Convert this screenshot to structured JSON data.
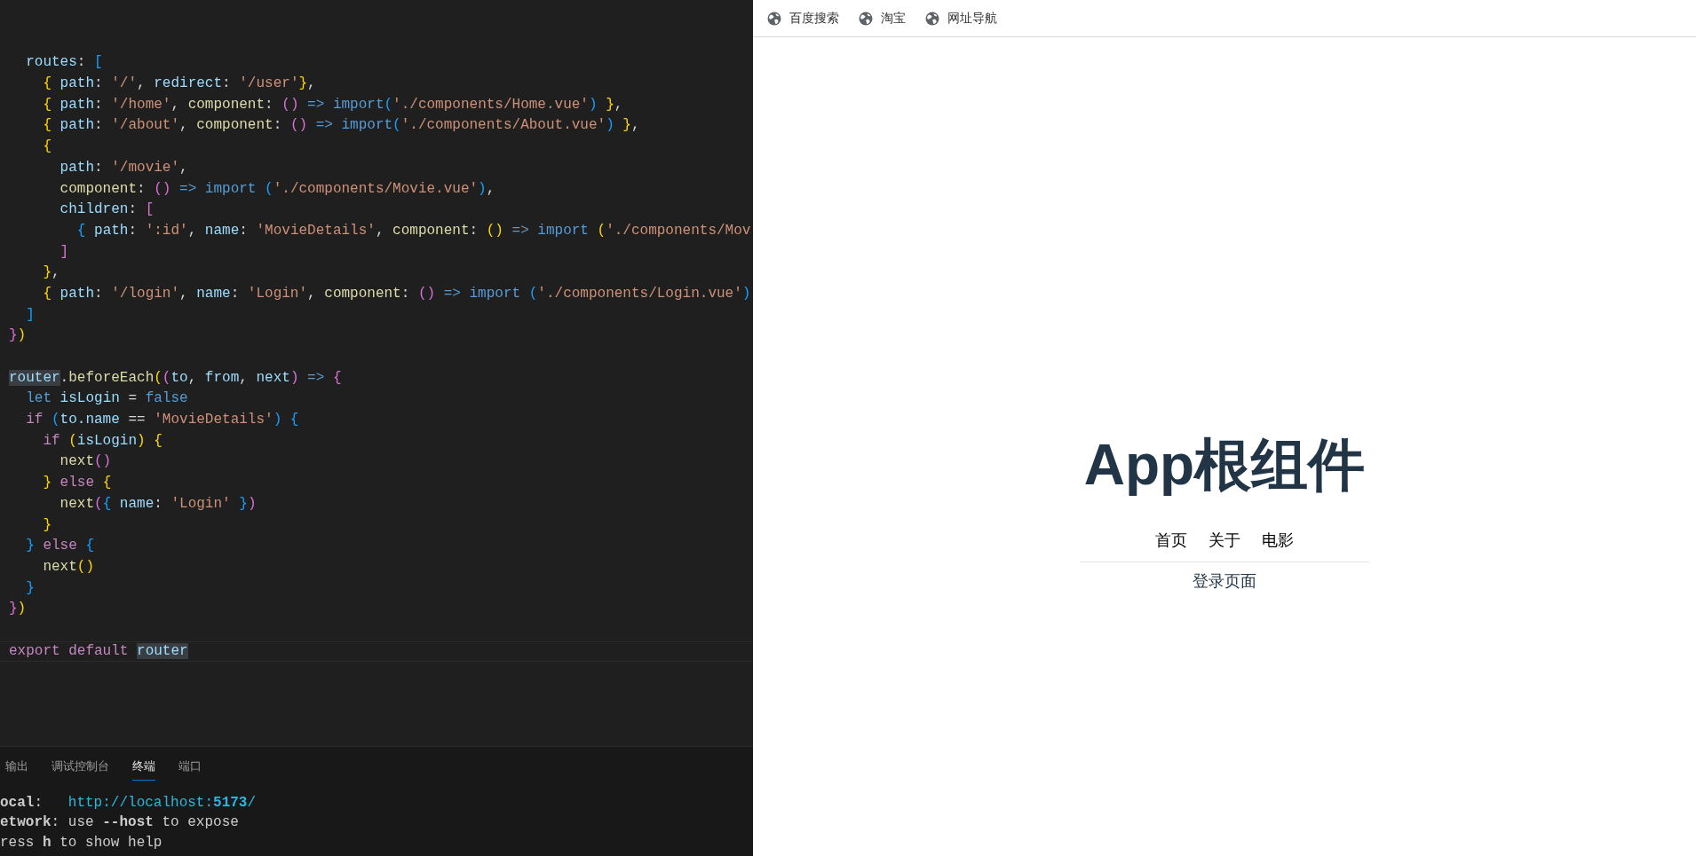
{
  "editor": {
    "lines": [
      {
        "kind": "blank"
      },
      {
        "kind": "blank"
      },
      {
        "kind": "code",
        "tokens": [
          {
            "kind": "prop",
            "text": "  routes"
          },
          {
            "kind": "plain",
            "text": ": "
          },
          {
            "kind": "blue",
            "text": "["
          }
        ]
      },
      {
        "kind": "code",
        "tokens": [
          {
            "kind": "gold",
            "text": "    {"
          },
          {
            "kind": "prop",
            "text": " path"
          },
          {
            "kind": "plain",
            "text": ": "
          },
          {
            "kind": "str",
            "text": "'/'"
          },
          {
            "kind": "plain",
            "text": ", "
          },
          {
            "kind": "prop",
            "text": "redirect"
          },
          {
            "kind": "plain",
            "text": ": "
          },
          {
            "kind": "str",
            "text": "'/user'"
          },
          {
            "kind": "gold",
            "text": "}"
          },
          {
            "kind": "plain",
            "text": ","
          }
        ]
      },
      {
        "kind": "code",
        "tokens": [
          {
            "kind": "gold",
            "text": "    {"
          },
          {
            "kind": "prop",
            "text": " path"
          },
          {
            "kind": "plain",
            "text": ": "
          },
          {
            "kind": "str",
            "text": "'/home'"
          },
          {
            "kind": "plain",
            "text": ", "
          },
          {
            "kind": "fn",
            "text": "component"
          },
          {
            "kind": "plain",
            "text": ": "
          },
          {
            "kind": "pink",
            "text": "()"
          },
          {
            "kind": "kw",
            "text": " => import"
          },
          {
            "kind": "blue",
            "text": "("
          },
          {
            "kind": "str",
            "text": "'./components/Home.vue'"
          },
          {
            "kind": "blue",
            "text": ")"
          },
          {
            "kind": "gold",
            "text": " }"
          },
          {
            "kind": "plain",
            "text": ","
          }
        ]
      },
      {
        "kind": "code",
        "tokens": [
          {
            "kind": "gold",
            "text": "    {"
          },
          {
            "kind": "prop",
            "text": " path"
          },
          {
            "kind": "plain",
            "text": ": "
          },
          {
            "kind": "str",
            "text": "'/about'"
          },
          {
            "kind": "plain",
            "text": ", "
          },
          {
            "kind": "fn",
            "text": "component"
          },
          {
            "kind": "plain",
            "text": ": "
          },
          {
            "kind": "pink",
            "text": "()"
          },
          {
            "kind": "kw",
            "text": " => import"
          },
          {
            "kind": "blue",
            "text": "("
          },
          {
            "kind": "str",
            "text": "'./components/About.vue'"
          },
          {
            "kind": "blue",
            "text": ")"
          },
          {
            "kind": "gold",
            "text": " }"
          },
          {
            "kind": "plain",
            "text": ","
          }
        ]
      },
      {
        "kind": "code",
        "tokens": [
          {
            "kind": "gold",
            "text": "    {"
          }
        ]
      },
      {
        "kind": "code",
        "tokens": [
          {
            "kind": "prop",
            "text": "      path"
          },
          {
            "kind": "plain",
            "text": ": "
          },
          {
            "kind": "str",
            "text": "'/movie'"
          },
          {
            "kind": "plain",
            "text": ","
          }
        ]
      },
      {
        "kind": "code",
        "tokens": [
          {
            "kind": "fn",
            "text": "      component"
          },
          {
            "kind": "plain",
            "text": ": "
          },
          {
            "kind": "pink",
            "text": "()"
          },
          {
            "kind": "kw",
            "text": " => import "
          },
          {
            "kind": "blue",
            "text": "("
          },
          {
            "kind": "str",
            "text": "'./components/Movie.vue'"
          },
          {
            "kind": "blue",
            "text": ")"
          },
          {
            "kind": "plain",
            "text": ","
          }
        ]
      },
      {
        "kind": "code",
        "tokens": [
          {
            "kind": "prop",
            "text": "      children"
          },
          {
            "kind": "plain",
            "text": ": "
          },
          {
            "kind": "pink",
            "text": "["
          }
        ]
      },
      {
        "kind": "code",
        "tokens": [
          {
            "kind": "blue",
            "text": "        {"
          },
          {
            "kind": "prop",
            "text": " path"
          },
          {
            "kind": "plain",
            "text": ": "
          },
          {
            "kind": "str",
            "text": "':id'"
          },
          {
            "kind": "plain",
            "text": ", "
          },
          {
            "kind": "prop",
            "text": "name"
          },
          {
            "kind": "plain",
            "text": ": "
          },
          {
            "kind": "str",
            "text": "'MovieDetails'"
          },
          {
            "kind": "plain",
            "text": ", "
          },
          {
            "kind": "fn",
            "text": "component"
          },
          {
            "kind": "plain",
            "text": ": "
          },
          {
            "kind": "gold",
            "text": "()"
          },
          {
            "kind": "kw",
            "text": " => import "
          },
          {
            "kind": "gold",
            "text": "("
          },
          {
            "kind": "str",
            "text": "'./components/Mov"
          }
        ]
      },
      {
        "kind": "code",
        "tokens": [
          {
            "kind": "pink",
            "text": "      ]"
          }
        ]
      },
      {
        "kind": "code",
        "tokens": [
          {
            "kind": "gold",
            "text": "    }"
          },
          {
            "kind": "plain",
            "text": ","
          }
        ]
      },
      {
        "kind": "code",
        "tokens": [
          {
            "kind": "gold",
            "text": "    {"
          },
          {
            "kind": "prop",
            "text": " path"
          },
          {
            "kind": "plain",
            "text": ": "
          },
          {
            "kind": "str",
            "text": "'/login'"
          },
          {
            "kind": "plain",
            "text": ", "
          },
          {
            "kind": "prop",
            "text": "name"
          },
          {
            "kind": "plain",
            "text": ": "
          },
          {
            "kind": "str",
            "text": "'Login'"
          },
          {
            "kind": "plain",
            "text": ", "
          },
          {
            "kind": "fn",
            "text": "component"
          },
          {
            "kind": "plain",
            "text": ": "
          },
          {
            "kind": "pink",
            "text": "()"
          },
          {
            "kind": "kw",
            "text": " => import "
          },
          {
            "kind": "blue",
            "text": "("
          },
          {
            "kind": "str",
            "text": "'./components/Login.vue'"
          },
          {
            "kind": "blue",
            "text": ")"
          }
        ]
      },
      {
        "kind": "code",
        "tokens": [
          {
            "kind": "blue",
            "text": "  ]"
          }
        ]
      },
      {
        "kind": "code",
        "tokens": [
          {
            "kind": "pink",
            "text": "}"
          },
          {
            "kind": "gold",
            "text": ")"
          }
        ]
      },
      {
        "kind": "blank"
      },
      {
        "kind": "code",
        "tokens": [
          {
            "kind": "match",
            "text": "router"
          },
          {
            "kind": "plain",
            "text": "."
          },
          {
            "kind": "fn",
            "text": "beforeEach"
          },
          {
            "kind": "gold",
            "text": "("
          },
          {
            "kind": "pink",
            "text": "("
          },
          {
            "kind": "prop",
            "text": "to"
          },
          {
            "kind": "plain",
            "text": ", "
          },
          {
            "kind": "prop",
            "text": "from"
          },
          {
            "kind": "plain",
            "text": ", "
          },
          {
            "kind": "prop",
            "text": "next"
          },
          {
            "kind": "pink",
            "text": ")"
          },
          {
            "kind": "kw",
            "text": " => "
          },
          {
            "kind": "pink",
            "text": "{"
          }
        ]
      },
      {
        "kind": "code",
        "tokens": [
          {
            "kind": "kw",
            "text": "  let"
          },
          {
            "kind": "prop",
            "text": " isLogin"
          },
          {
            "kind": "plain",
            "text": " = "
          },
          {
            "kind": "kw",
            "text": "false"
          }
        ]
      },
      {
        "kind": "code",
        "tokens": [
          {
            "kind": "ctl",
            "text": "  if"
          },
          {
            "kind": "blue",
            "text": " ("
          },
          {
            "kind": "prop",
            "text": "to.name"
          },
          {
            "kind": "plain",
            "text": " == "
          },
          {
            "kind": "str",
            "text": "'MovieDetails'"
          },
          {
            "kind": "blue",
            "text": ")"
          },
          {
            "kind": "blue",
            "text": " {"
          }
        ]
      },
      {
        "kind": "code",
        "tokens": [
          {
            "kind": "ctl",
            "text": "    if"
          },
          {
            "kind": "gold",
            "text": " ("
          },
          {
            "kind": "prop",
            "text": "isLogin"
          },
          {
            "kind": "gold",
            "text": ")"
          },
          {
            "kind": "gold",
            "text": " {"
          }
        ]
      },
      {
        "kind": "code",
        "tokens": [
          {
            "kind": "fn",
            "text": "      next"
          },
          {
            "kind": "pink",
            "text": "()"
          }
        ]
      },
      {
        "kind": "code",
        "tokens": [
          {
            "kind": "gold",
            "text": "    }"
          },
          {
            "kind": "ctl",
            "text": " else"
          },
          {
            "kind": "gold",
            "text": " {"
          }
        ]
      },
      {
        "kind": "code",
        "tokens": [
          {
            "kind": "fn",
            "text": "      next"
          },
          {
            "kind": "pink",
            "text": "("
          },
          {
            "kind": "blue",
            "text": "{"
          },
          {
            "kind": "prop",
            "text": " name"
          },
          {
            "kind": "plain",
            "text": ": "
          },
          {
            "kind": "str",
            "text": "'Login'"
          },
          {
            "kind": "blue",
            "text": " }"
          },
          {
            "kind": "pink",
            "text": ")"
          }
        ]
      },
      {
        "kind": "code",
        "tokens": [
          {
            "kind": "gold",
            "text": "    }"
          }
        ]
      },
      {
        "kind": "code",
        "tokens": [
          {
            "kind": "blue",
            "text": "  }"
          },
          {
            "kind": "ctl",
            "text": " else"
          },
          {
            "kind": "blue",
            "text": " {"
          }
        ]
      },
      {
        "kind": "code",
        "tokens": [
          {
            "kind": "fn",
            "text": "    next"
          },
          {
            "kind": "gold",
            "text": "()"
          }
        ]
      },
      {
        "kind": "code",
        "tokens": [
          {
            "kind": "blue",
            "text": "  }"
          }
        ]
      },
      {
        "kind": "code",
        "tokens": [
          {
            "kind": "pink",
            "text": "}"
          },
          {
            "kind": "gold",
            "text": ")"
          }
        ]
      },
      {
        "kind": "blank"
      },
      {
        "kind": "current",
        "tokens": [
          {
            "kind": "ctl",
            "text": "export default "
          },
          {
            "kind": "match",
            "text": "router"
          }
        ]
      }
    ]
  },
  "panel": {
    "tabs": [
      {
        "label": "输出",
        "selected": false
      },
      {
        "label": "调试控制台",
        "selected": false
      },
      {
        "label": "终端",
        "selected": true
      },
      {
        "label": "端口",
        "selected": false
      }
    ],
    "terminal": [
      [
        {
          "kind": "text",
          "text": "**ocal**:   "
        },
        {
          "kind": "link",
          "text": "http://localhost:**5173**/"
        }
      ],
      [
        {
          "kind": "text",
          "text": "**etwork**: use **--host** to expose"
        }
      ],
      [
        {
          "kind": "text",
          "text": "ress **h** to show help"
        }
      ]
    ]
  },
  "browser": {
    "bookmarks": [
      "百度搜索",
      "淘宝",
      "网址导航"
    ],
    "title": "App根组件",
    "nav": [
      "首页",
      "关于",
      "电影"
    ],
    "view": "登录页面"
  }
}
